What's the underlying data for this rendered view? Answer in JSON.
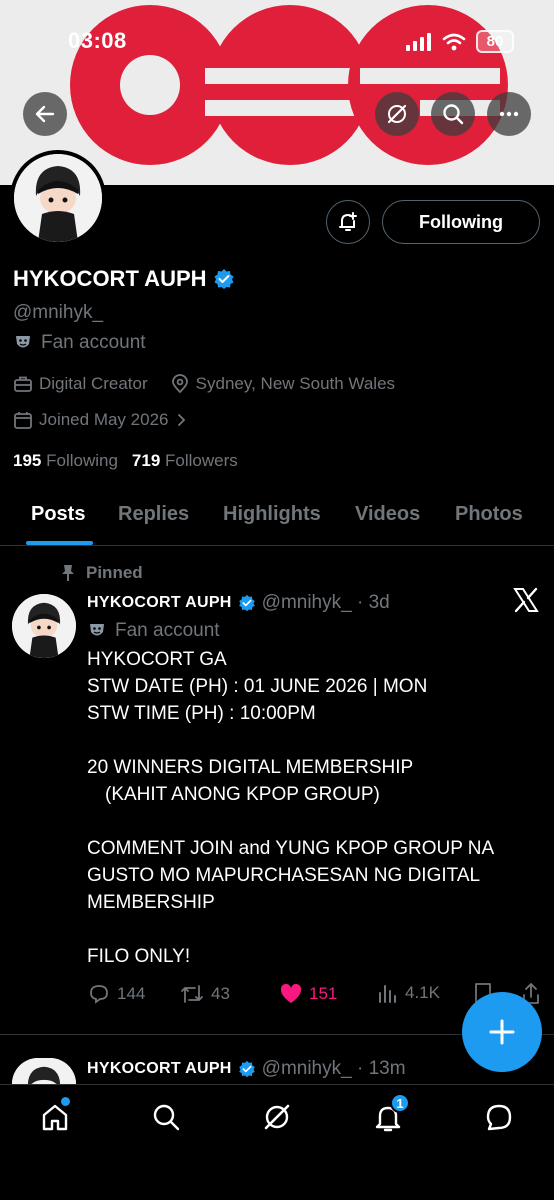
{
  "status_bar": {
    "time": "03:08",
    "battery": "80"
  },
  "banner": {
    "brand_color": "#e0203a"
  },
  "profile": {
    "name": "HYKOCORT AUPH",
    "handle": "@mnihyk_",
    "label": "Fan account",
    "category": "Digital Creator",
    "location": "Sydney, New South Wales",
    "joined": "Joined May 2026",
    "following_count": "195",
    "following_label": "Following",
    "followers_count": "719",
    "followers_label": "Followers",
    "follow_button": "Following"
  },
  "tabs": [
    {
      "label": "Posts",
      "active": true
    },
    {
      "label": "Replies"
    },
    {
      "label": "Highlights"
    },
    {
      "label": "Videos"
    },
    {
      "label": "Photos"
    }
  ],
  "posts": [
    {
      "pinned_label": "Pinned",
      "name": "HYKOCORT AUPH",
      "handle_time": "@mnihyk_ · 3d",
      "label": "Fan account",
      "lines": [
        "HYKOCORT GA",
        "STW DATE (PH) : 01 JUNE 2026 | MON",
        "STW TIME (PH)  : 10:00PM",
        "",
        "20 WINNERS DIGITAL MEMBERSHIP",
        "(KAHIT ANONG KPOP GROUP)",
        "",
        "COMMENT JOIN and YUNG KPOP GROUP NA",
        "GUSTO MO MAPURCHASESAN NG DIGITAL",
        "MEMBERSHIP",
        "",
        "FILO ONLY!"
      ],
      "replies": "144",
      "reposts": "43",
      "likes": "151",
      "views": "4.1K"
    },
    {
      "name": "HYKOCORT AUPH",
      "handle_time": "@mnihyk_ · 13m"
    }
  ],
  "bottom_nav": {
    "notifications_badge": "1"
  },
  "colors": {
    "accent": "#1d9bf0",
    "like": "#f91880",
    "verified": "#1d9bf0"
  }
}
